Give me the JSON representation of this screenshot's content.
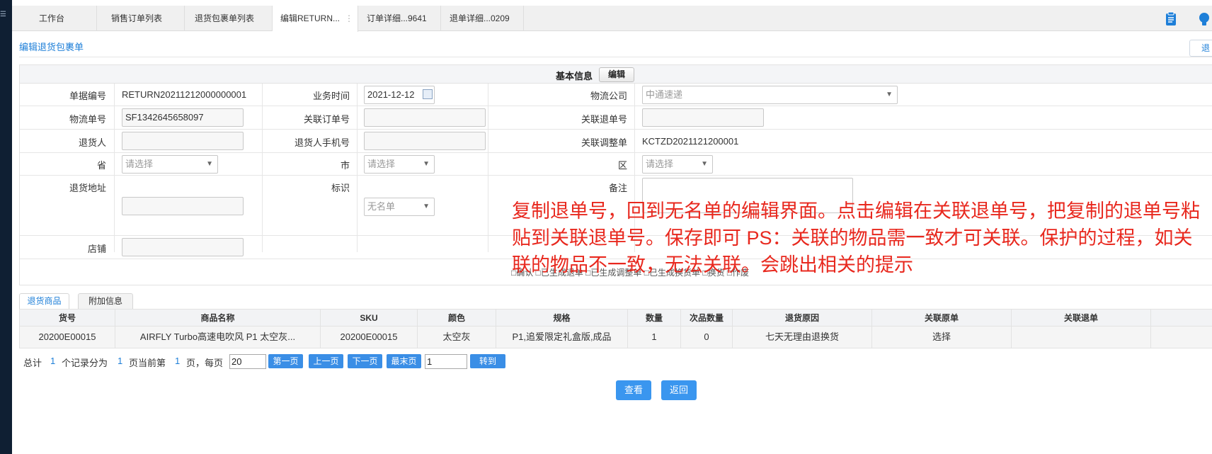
{
  "tabs": [
    {
      "label": "工作台"
    },
    {
      "label": "销售订单列表"
    },
    {
      "label": "退货包裹单列表"
    },
    {
      "label": "编辑RETURN..."
    },
    {
      "label": "订单详细...9641"
    },
    {
      "label": "退单详细...0209"
    }
  ],
  "page": {
    "title": "编辑退货包裹单",
    "right_btn": "退"
  },
  "form": {
    "section_title": "基本信息",
    "edit_btn": "编辑",
    "doc_no_label": "单据编号",
    "doc_no": "RETURN20211212000000001",
    "biz_time_label": "业务时间",
    "biz_time": "2021-12-12",
    "logistics_co_label": "物流公司",
    "logistics_co": "中通速递",
    "tracking_label": "物流单号",
    "tracking": "SF1342645658097",
    "rel_order_label": "关联订单号",
    "rel_order": "",
    "rel_return_label": "关联退单号",
    "rel_return": "",
    "returner_label": "退货人",
    "returner": "",
    "returner_phone_label": "退货人手机号",
    "returner_phone": "",
    "rel_adjust_label": "关联调整单",
    "rel_adjust": "KCTZD2021121200001",
    "province_label": "省",
    "province_ph": "请选择",
    "city_label": "市",
    "city_ph": "请选择",
    "district_label": "区",
    "district_ph": "请选择",
    "address_label": "退货地址",
    "address": "",
    "mark_label": "标识",
    "mark": "无名单",
    "remark_label": "备注",
    "store_label": "店铺",
    "store": "",
    "status_line": "□确认  □已生成退单  □已生成调整单  □已生成换货单  □换货  □作废"
  },
  "subtabs": [
    {
      "label": "退货商品"
    },
    {
      "label": "附加信息"
    }
  ],
  "grid": {
    "headers": [
      "货号",
      "商品名称",
      "SKU",
      "颜色",
      "规格",
      "数量",
      "次品数量",
      "退货原因",
      "关联原单",
      "关联退单"
    ],
    "rows": [
      [
        "20200E00015",
        "AIRFLY Turbo高速电吹风 P1 太空灰...",
        "20200E00015",
        "太空灰",
        "P1,追爱限定礼盒版,成品",
        "1",
        "0",
        "七天无理由退换货",
        "选择",
        ""
      ]
    ]
  },
  "pager": {
    "total_prefix": "总计",
    "total": "1",
    "records_split": "个记录分为",
    "pages": "1",
    "page_current_prefix": "页当前第",
    "current": "1",
    "per_page_prefix": "页，每页",
    "per_page": "20",
    "first": "第一页",
    "prev": "上一页",
    "next": "下一页",
    "last": "最末页",
    "goto_value": "1",
    "goto": "转到"
  },
  "actions": {
    "view": "查看",
    "back": "返回"
  },
  "annotation": "复制退单号，回到无名单的编辑界面。点击编辑在关联退单号，把复制的退单号粘贴到关联退单号。保存即可 PS：关联的物品需一致才可关联。保护的过程，如关联的物品不一致，无法关联。会跳出相关的提示",
  "colors": {
    "accent": "#1e7fd8",
    "button_blue": "#3a96ef",
    "annotation_red": "#e8281e",
    "sidebar": "#0f1f33"
  }
}
